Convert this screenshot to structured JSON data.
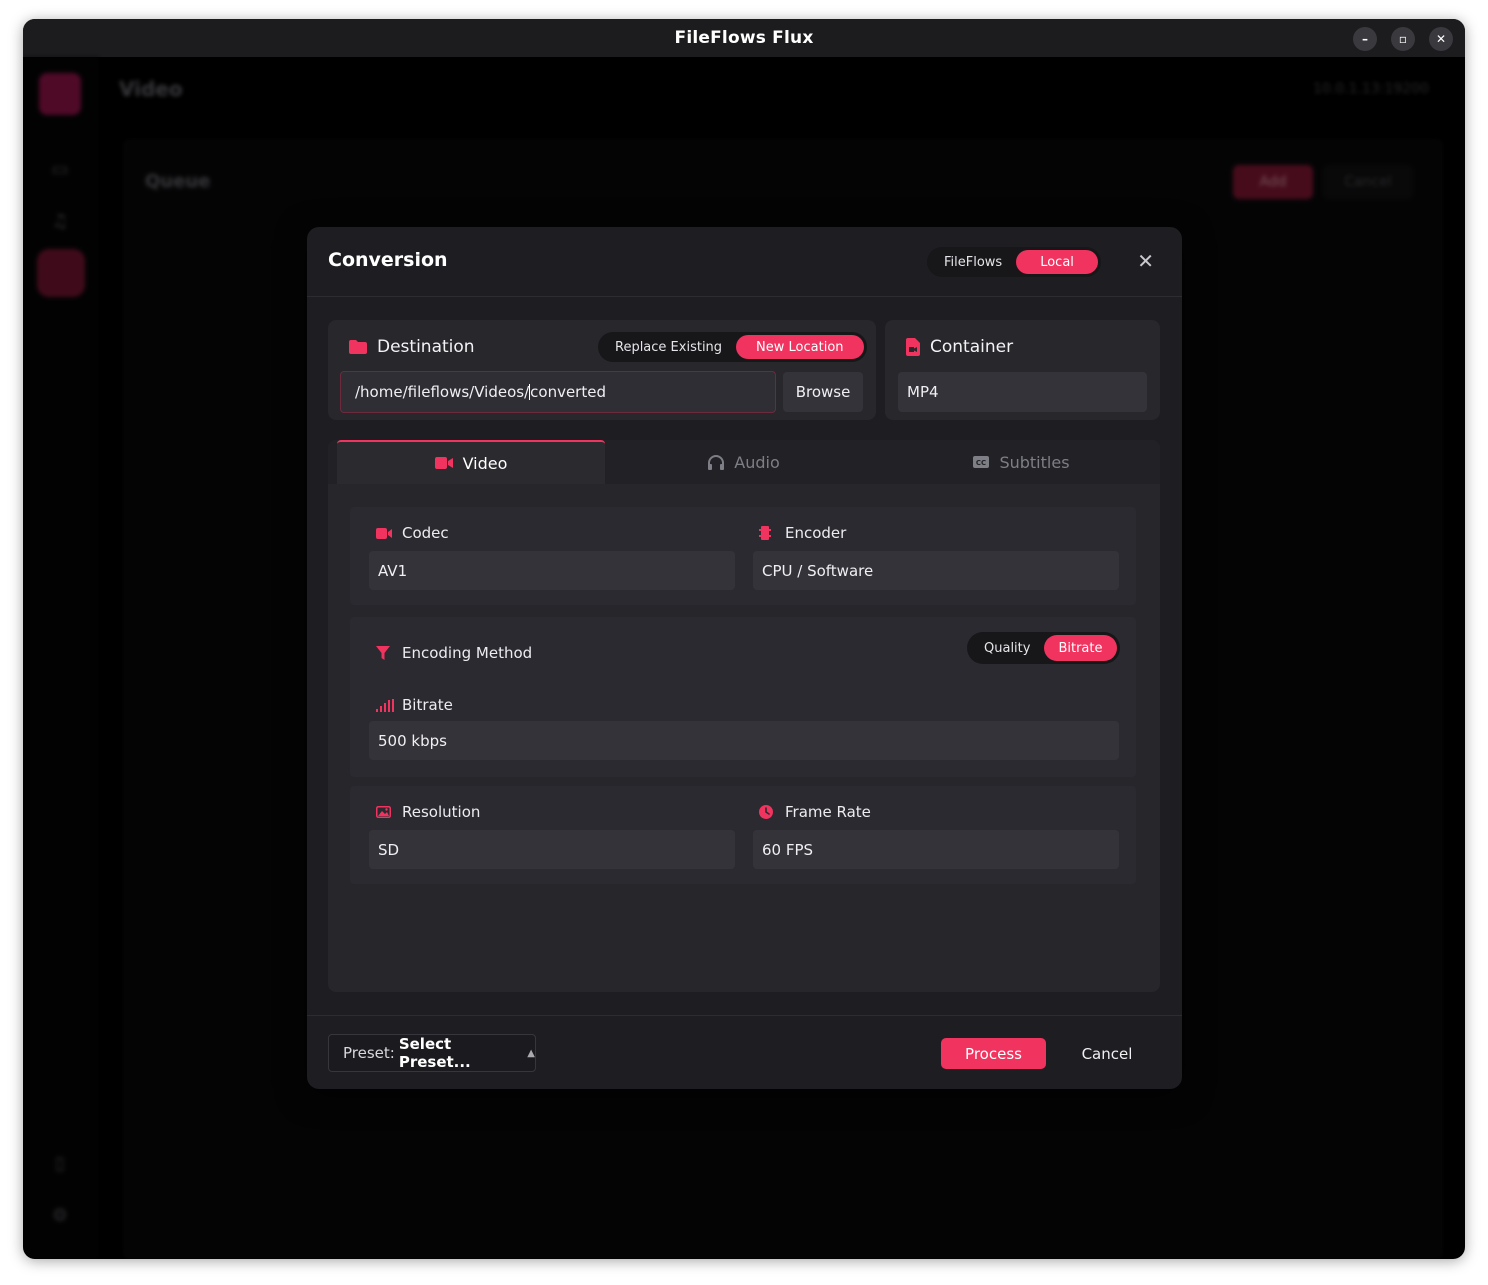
{
  "window": {
    "title": "FileFlows Flux",
    "controls": [
      "minimize-icon",
      "maximize-icon",
      "close-icon"
    ]
  },
  "background": {
    "section_title": "Video",
    "server_address": "10.0.1.13:19200",
    "page_title": "Queue",
    "add_label": "Add",
    "cancel_label": "Cancel"
  },
  "modal": {
    "title": "Conversion",
    "mode_options": [
      "FileFlows",
      "Local"
    ],
    "mode_selected": "Local",
    "destination": {
      "title": "Destination",
      "options": [
        "Replace Existing",
        "New Location"
      ],
      "selected": "New Location",
      "path_before_caret": "/home/fileflows/Videos/",
      "path_after_caret": "converted",
      "browse_label": "Browse"
    },
    "container": {
      "title": "Container",
      "value": "MP4"
    },
    "tabs": [
      {
        "label": "Video",
        "icon": "video-camera-icon",
        "active": true
      },
      {
        "label": "Audio",
        "icon": "headphones-icon",
        "active": false
      },
      {
        "label": "Subtitles",
        "icon": "closed-caption-icon",
        "active": false
      }
    ],
    "video": {
      "codec_label": "Codec",
      "codec_value": "AV1",
      "encoder_label": "Encoder",
      "encoder_value": "CPU / Software",
      "encoding_method_label": "Encoding Method",
      "encoding_method_options": [
        "Quality",
        "Bitrate"
      ],
      "encoding_method_selected": "Bitrate",
      "bitrate_label": "Bitrate",
      "bitrate_value": "500 kbps",
      "resolution_label": "Resolution",
      "resolution_value": "SD",
      "frame_rate_label": "Frame Rate",
      "frame_rate_value": "60 FPS"
    },
    "footer": {
      "preset_prefix": "Preset:",
      "preset_value": "Select Preset...",
      "process_label": "Process",
      "cancel_label": "Cancel"
    }
  },
  "colors": {
    "accent": "#f0335f",
    "modal_bg": "#1e1e22",
    "panel_bg": "#27272c",
    "field_bg": "#333339"
  }
}
